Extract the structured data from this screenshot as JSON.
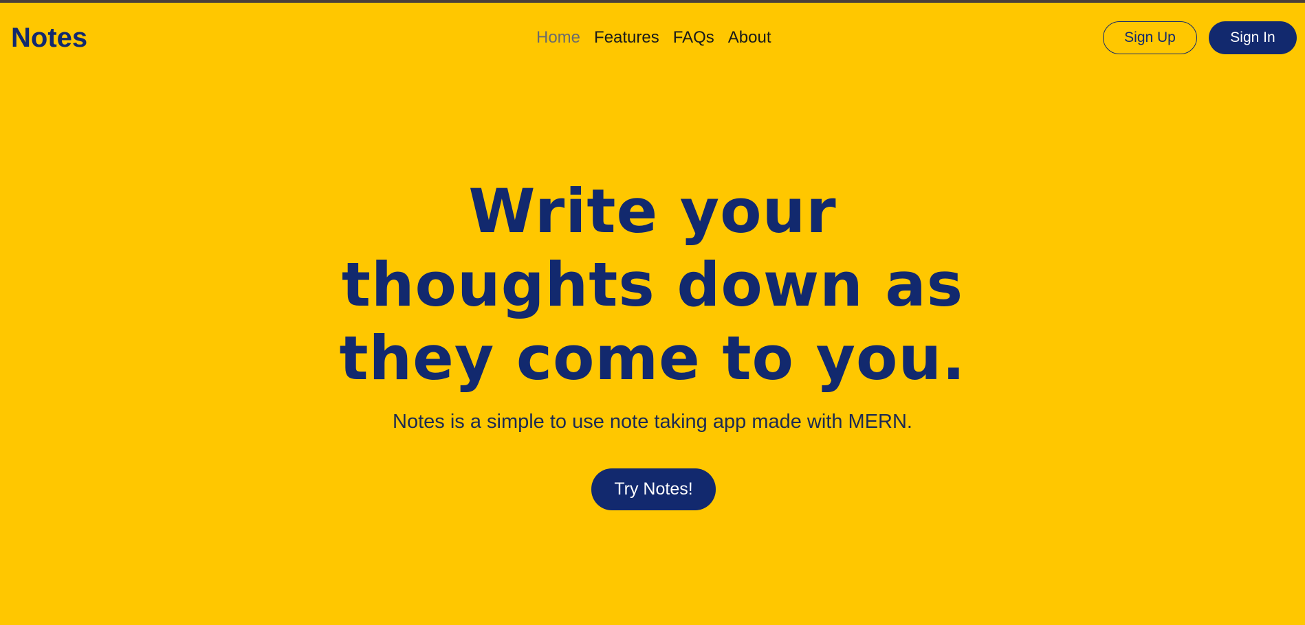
{
  "header": {
    "brand": "Notes",
    "nav": [
      {
        "label": "Home",
        "active": true
      },
      {
        "label": "Features",
        "active": false
      },
      {
        "label": "FAQs",
        "active": false
      },
      {
        "label": "About",
        "active": false
      }
    ],
    "signup_label": "Sign Up",
    "signin_label": "Sign In"
  },
  "hero": {
    "title": "Write your thoughts down as they come to you.",
    "subtitle": "Notes is a simple to use note taking app made with MERN.",
    "cta_label": "Try Notes!"
  },
  "colors": {
    "background": "#ffc700",
    "primary": "#12296e",
    "top_strip": "#4a3f3a"
  }
}
